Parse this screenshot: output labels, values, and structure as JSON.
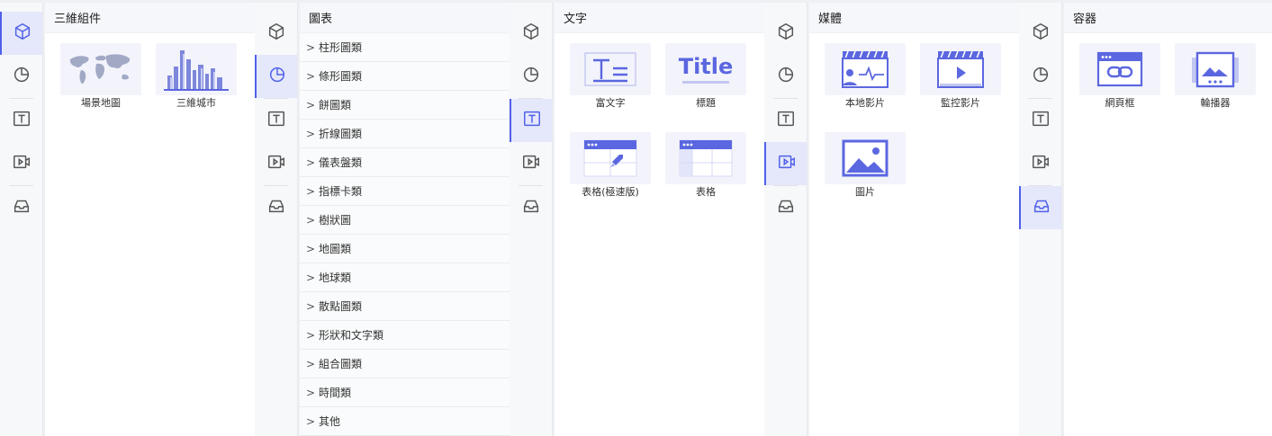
{
  "colors": {
    "accent": "#4f60e8",
    "rail_active_bg": "#e5e8fb"
  },
  "rail_icons": [
    "cube-icon",
    "pie-chart-icon",
    "text-box-icon",
    "video-icon",
    "inbox-icon"
  ],
  "panels": [
    {
      "title": "三維組件",
      "items": [
        {
          "label": "場景地圖"
        },
        {
          "label": "三維城市"
        }
      ]
    },
    {
      "title": "圖表",
      "items": [
        {
          "label": "柱形圖類"
        },
        {
          "label": "條形圖類"
        },
        {
          "label": "餅圖類"
        },
        {
          "label": "折線圖類"
        },
        {
          "label": "儀表盤類"
        },
        {
          "label": "指標卡類"
        },
        {
          "label": "樹狀圖"
        },
        {
          "label": "地圖類"
        },
        {
          "label": "地球類"
        },
        {
          "label": "散點圖類"
        },
        {
          "label": "形狀和文字類"
        },
        {
          "label": "組合圖類"
        },
        {
          "label": "時間類"
        },
        {
          "label": "其他"
        }
      ]
    },
    {
      "title": "文字",
      "items": [
        {
          "label": "富文字"
        },
        {
          "label": "標題",
          "thumb_text": "Title"
        },
        {
          "label": "表格(極速版)"
        },
        {
          "label": "表格"
        }
      ]
    },
    {
      "title": "媒體",
      "items": [
        {
          "label": "本地影片"
        },
        {
          "label": "監控影片"
        },
        {
          "label": "圖片"
        }
      ]
    },
    {
      "title": "容器",
      "items": [
        {
          "label": "網頁框"
        },
        {
          "label": "輪播器"
        }
      ]
    }
  ]
}
